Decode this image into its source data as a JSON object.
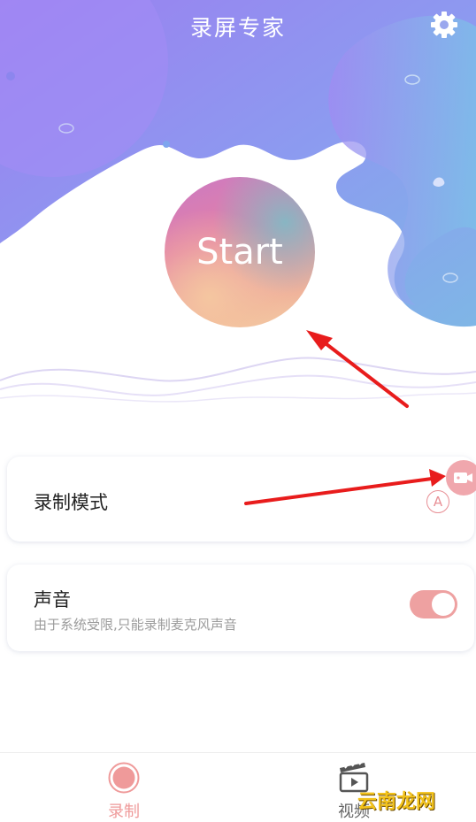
{
  "header": {
    "title": "录屏专家"
  },
  "hero": {
    "start_label": "Start"
  },
  "mode_card": {
    "label": "录制模式",
    "badge": "A"
  },
  "sound_card": {
    "label": "声音",
    "description": "由于系统受限,只能录制麦克风声音",
    "enabled": true
  },
  "bottom_nav": {
    "record_label": "录制",
    "video_label": "视频"
  },
  "watermark": "云南龙网",
  "icons": {
    "settings": "gear-icon",
    "record": "record-icon",
    "video": "clapperboard-icon",
    "floating": "camera-icon"
  },
  "colors": {
    "accent": "#ef9a9a",
    "toggle_on": "#eea1a1",
    "annotation_arrow": "#e81c1c"
  }
}
